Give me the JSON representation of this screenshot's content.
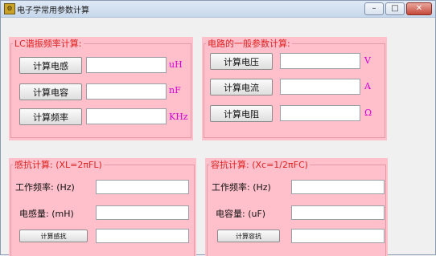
{
  "window": {
    "title": "电子学常用参数计算",
    "icon": "app-icon",
    "controls": {
      "minimize": "–",
      "maximize": "□",
      "close": "✕"
    }
  },
  "lc_panel": {
    "legend": "LC谐振频率计算:",
    "rows": [
      {
        "button": "计算电感",
        "value": "",
        "unit": "uH"
      },
      {
        "button": "计算电容",
        "value": "",
        "unit": "nF"
      },
      {
        "button": "计算频率",
        "value": "",
        "unit": "KHz"
      }
    ]
  },
  "circuit_panel": {
    "legend": "电路的一般参数计算:",
    "rows": [
      {
        "button": "计算电压",
        "value": "",
        "unit": "V"
      },
      {
        "button": "计算电流",
        "value": "",
        "unit": "A"
      },
      {
        "button": "计算电阻",
        "value": "",
        "unit": "Ω"
      }
    ]
  },
  "inductive_panel": {
    "legend": "感抗计算: (XL=2πFL)",
    "freq_label": "工作频率: (Hz)",
    "freq_value": "",
    "amount_label": "电感量: (mH)",
    "amount_value": "",
    "button": "计算感抗",
    "result_value": ""
  },
  "capacitive_panel": {
    "legend": "容抗计算: (Xc=1/2πFC)",
    "freq_label": "工作频率: (Hz)",
    "freq_value": "",
    "amount_label": "电容量: (uF)",
    "amount_value": "",
    "button": "计算容抗",
    "result_value": ""
  },
  "colors": {
    "panel_bg": "#ffc0cb",
    "legend_text": "#dd2222",
    "unit_text": "#d400d4"
  }
}
